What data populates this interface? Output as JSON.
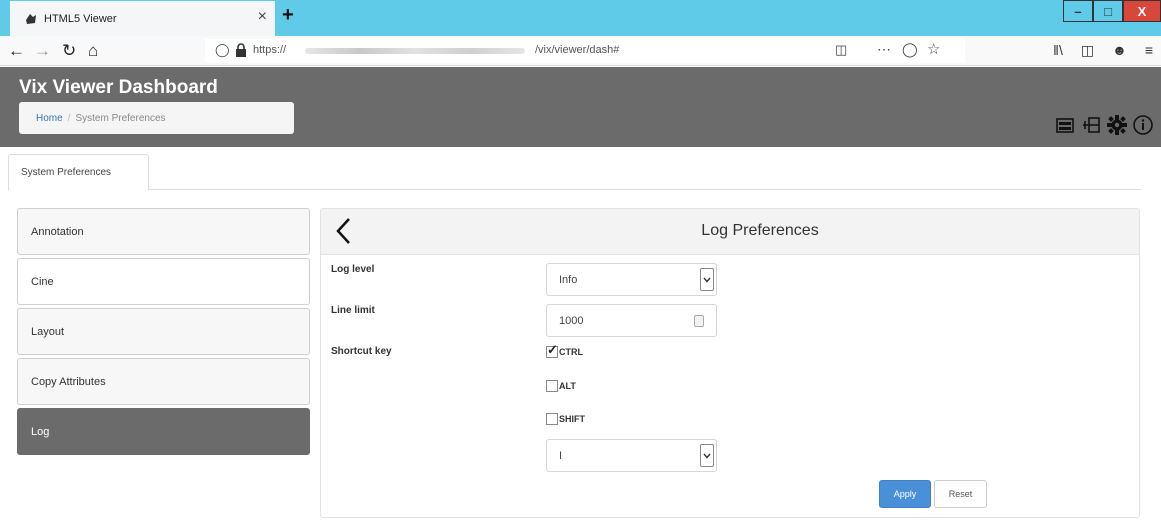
{
  "browser": {
    "tab_title": "HTML5 Viewer",
    "tab_close": "×",
    "new_tab": "+",
    "url_prefix": "https://",
    "url_path": "/vix/viewer/dash#",
    "window_min": "–",
    "window_max": "□",
    "window_close": "X",
    "nav_icons": [
      "back-icon",
      "forward-icon",
      "reload-icon",
      "home-icon"
    ],
    "url_icons": [
      "shield-icon",
      "lock-icon",
      "reader-icon",
      "more-icon",
      "pocket-icon",
      "star-icon"
    ],
    "toolbar_icons": [
      "library-icon",
      "sidebar-icon",
      "account-icon",
      "menu-icon"
    ]
  },
  "app": {
    "title": "Vix Viewer Dashboard",
    "breadcrumb": {
      "home": "Home",
      "separator": "/",
      "current": "System Preferences"
    },
    "header_icons": [
      "dicom-icon",
      "layout-icon",
      "gear-icon",
      "info-icon"
    ],
    "colors": {
      "header": "#6b6b6b",
      "accent": "#4a90d9",
      "tabstrip": "#5fcbe8"
    }
  },
  "page_tab": "System Preferences",
  "menu": {
    "items": [
      {
        "label": "Annotation"
      },
      {
        "label": "Cine"
      },
      {
        "label": "Layout"
      },
      {
        "label": "Copy Attributes"
      },
      {
        "label": "Log",
        "active": true
      }
    ]
  },
  "panel": {
    "title": "Log Preferences",
    "log_level_label": "Log level",
    "log_level_value": "Info",
    "line_limit_label": "Line limit",
    "line_limit_value": "1000",
    "shortcut_label": "Shortcut key",
    "shortcuts": [
      {
        "label": "CTRL",
        "checked": true
      },
      {
        "label": "ALT",
        "checked": false
      },
      {
        "label": "SHIFT",
        "checked": false
      }
    ],
    "key_value": "I",
    "apply_label": "Apply",
    "reset_label": "Reset"
  }
}
